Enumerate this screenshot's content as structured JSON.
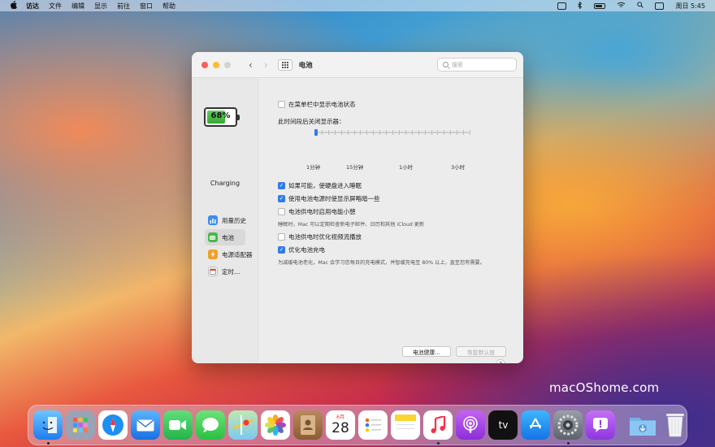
{
  "menubar": {
    "apple": "",
    "items": [
      "访达",
      "文件",
      "编辑",
      "显示",
      "前往",
      "窗口",
      "帮助"
    ],
    "clock": "周日 5:45"
  },
  "window": {
    "title": "电池",
    "search_placeholder": "搜索"
  },
  "battery": {
    "percent_label": "68%",
    "level_fraction": 0.68,
    "status": "Charging"
  },
  "sidebar": {
    "items": [
      {
        "label": "用量历史",
        "icon": "bar-chart-icon"
      },
      {
        "label": "电池",
        "icon": "battery-icon"
      },
      {
        "label": "电源适配器",
        "icon": "power-adapter-icon"
      },
      {
        "label": "定时…",
        "icon": "calendar-icon"
      }
    ],
    "active_index": 1
  },
  "settings": {
    "show_in_menubar": {
      "label": "在菜单栏中显示电池状态",
      "checked": false
    },
    "display_off_label": "此时间段后关闭显示器：",
    "slider": {
      "value_label": "1分钟",
      "tick_labels": [
        "1分钟",
        "15分钟",
        "1小时",
        "3小时"
      ]
    },
    "sleep_disks": {
      "label": "如果可能，使硬盘进入睡眠",
      "checked": true
    },
    "dim_display": {
      "label": "使用电池电源时使显示屏略暗一些",
      "checked": true
    },
    "power_nap": {
      "label": "电池供电时启用电能小憩",
      "checked": false,
      "description": "睡眠时，Mac 可以定期检查新电子邮件、日历和其他 iCloud 更新"
    },
    "optimize_video": {
      "label": "电池供电时优化视频流播放",
      "checked": false
    },
    "optimized_charging": {
      "label": "优化电池充电",
      "checked": true,
      "description": "为减缓电池老化，Mac 会学习您每日的充电模式，并智缓充电至 80% 以上，直至您有需要。"
    }
  },
  "buttons": {
    "battery_health": "电池健康…",
    "restore_defaults": "恢复默认值",
    "help": "?"
  },
  "watermark": "macOShome.com",
  "dock": {
    "calendar_month": "6月",
    "calendar_day": "28",
    "apple_tv_label": "tv"
  },
  "colors": {
    "accent": "#2f7ce8",
    "battery_green": "#48b84a"
  }
}
